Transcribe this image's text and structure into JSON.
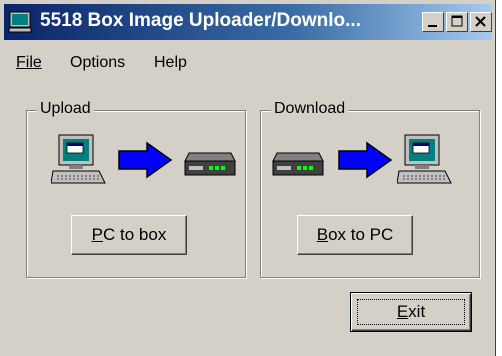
{
  "window": {
    "title": "5518 Box Image Uploader/Downlo...",
    "icon": "computer-icon",
    "controls": [
      "minimize-icon",
      "maximize-icon",
      "close-icon"
    ]
  },
  "menu": [
    {
      "label": "File"
    },
    {
      "label": "Options"
    },
    {
      "label": "Help"
    }
  ],
  "upload": {
    "label": "Upload",
    "button": "PC to box",
    "icons": [
      "computer-icon",
      "arrow-right-icon",
      "modem-box-icon"
    ]
  },
  "download": {
    "label": "Download",
    "button": "Box to PC",
    "icons": [
      "modem-box-icon",
      "arrow-right-icon",
      "computer-icon"
    ]
  },
  "exit_button": "Exit",
  "colors": {
    "titlebar_start": "#0a246a",
    "titlebar_end": "#a6caf0",
    "face": "#d4d0c8",
    "arrow": "#0000ff",
    "screen": "#008080"
  }
}
